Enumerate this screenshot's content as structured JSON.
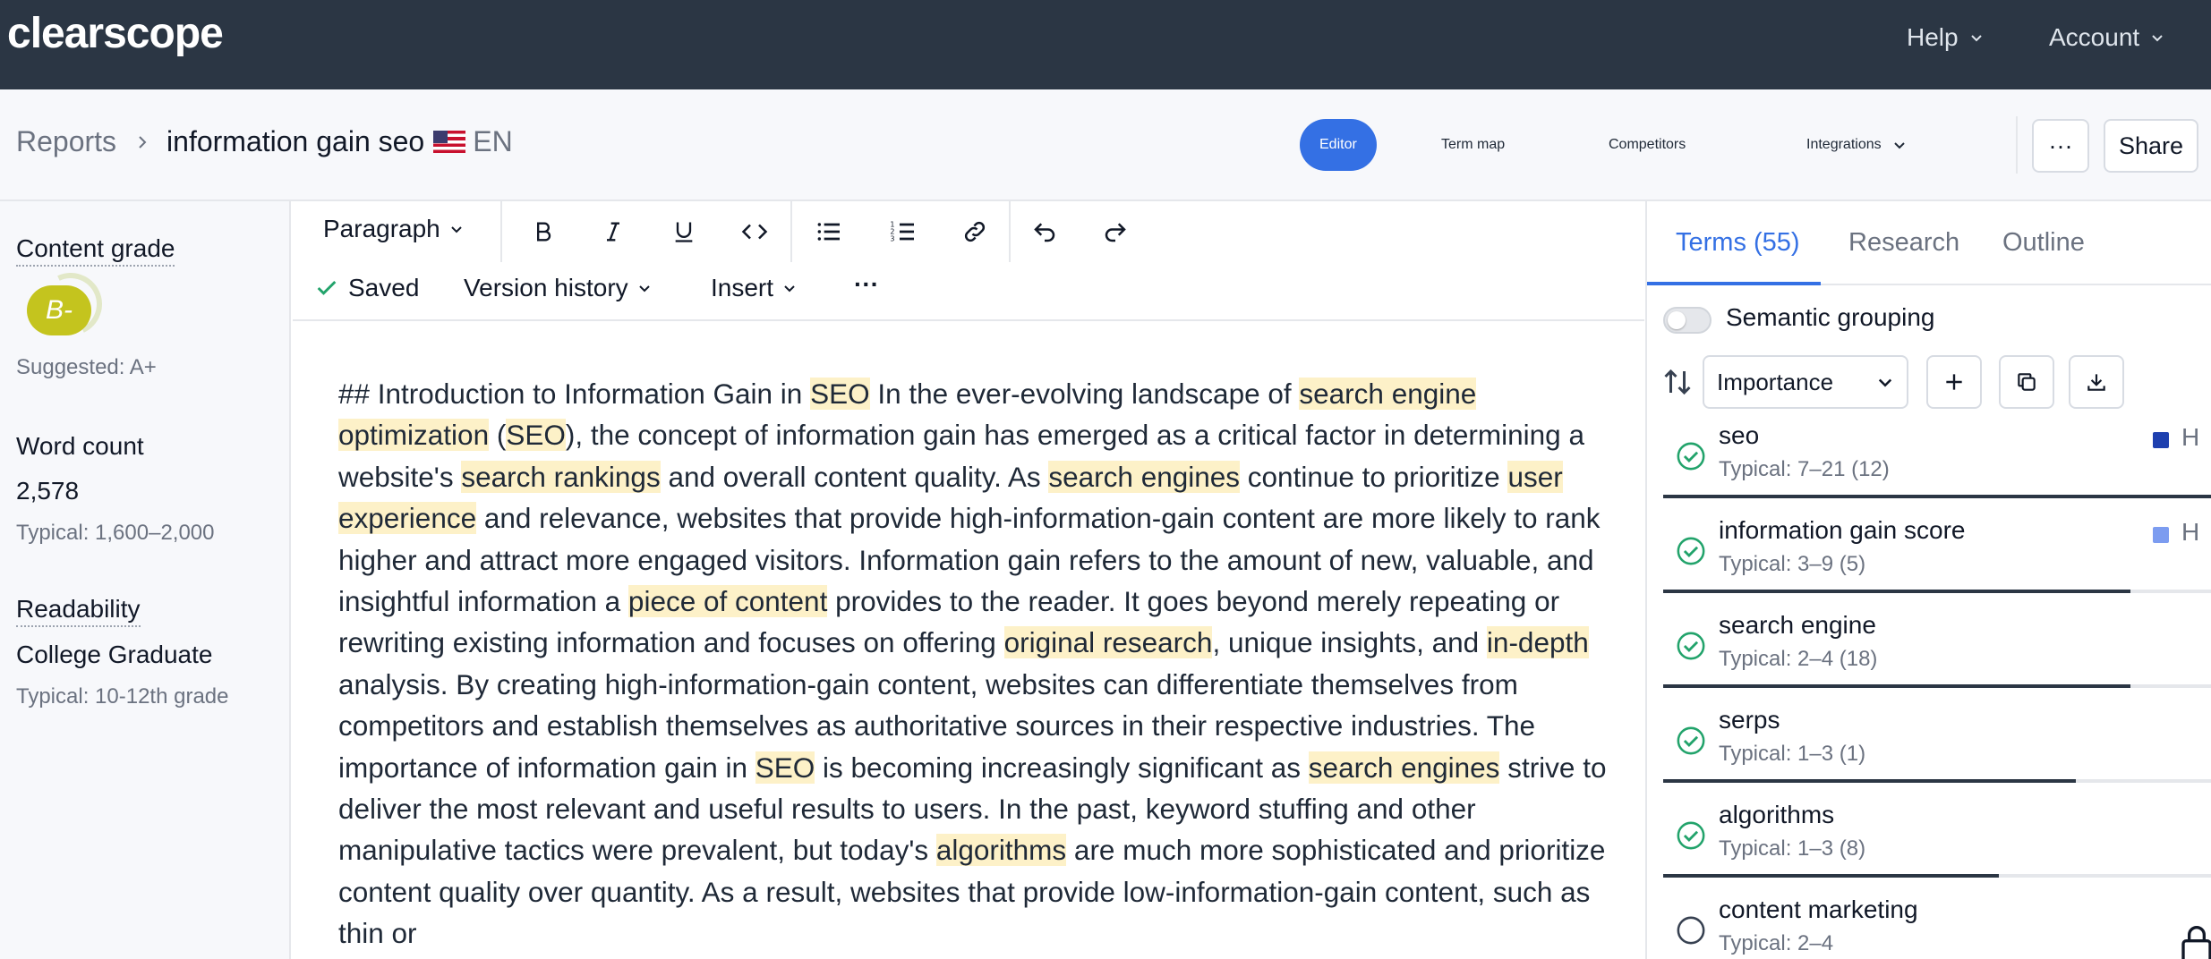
{
  "topbar": {
    "logo": "clearscope",
    "help": "Help",
    "account": "Account"
  },
  "header": {
    "breadcrumb_root": "Reports",
    "report_title": "information gain seo",
    "language": "EN",
    "tabs": {
      "editor": "Editor",
      "term_map": "Term map",
      "competitors": "Competitors",
      "integrations": "Integrations"
    },
    "more": "···",
    "share": "Share"
  },
  "sidebar": {
    "content_grade_label": "Content grade",
    "grade": "B-",
    "suggested": "Suggested: A+",
    "word_count_label": "Word count",
    "word_count": "2,578",
    "word_count_typical": "Typical: 1,600–2,000",
    "readability_label": "Readability",
    "readability": "College Graduate",
    "readability_typical": "Typical: 10-12th grade"
  },
  "toolbar": {
    "paragraph": "Paragraph",
    "saved": "Saved",
    "version_history": "Version history",
    "insert": "Insert",
    "more": "···"
  },
  "editor": {
    "segments": [
      {
        "t": "## Introduction to Information Gain in ",
        "h": false
      },
      {
        "t": "SEO",
        "h": true
      },
      {
        "t": " In the ever-evolving landscape of ",
        "h": false
      },
      {
        "t": "search engine optimization",
        "h": true
      },
      {
        "t": " (",
        "h": false
      },
      {
        "t": "SEO",
        "h": true
      },
      {
        "t": "), the concept of information gain has emerged as a critical factor in determining a website's ",
        "h": false
      },
      {
        "t": "search rankings",
        "h": true
      },
      {
        "t": " and overall content quality. As ",
        "h": false
      },
      {
        "t": "search engines",
        "h": true
      },
      {
        "t": " continue to prioritize ",
        "h": false
      },
      {
        "t": "user experience",
        "h": true
      },
      {
        "t": " and relevance, websites that provide high-information-gain content are more likely to rank higher and attract more engaged visitors. Information gain refers to the amount of new, valuable, and insightful information a ",
        "h": false
      },
      {
        "t": "piece of content",
        "h": true
      },
      {
        "t": " provides to the reader. It goes beyond merely repeating or rewriting existing information and focuses on offering ",
        "h": false
      },
      {
        "t": "original research",
        "h": true
      },
      {
        "t": ", unique insights, and ",
        "h": false
      },
      {
        "t": "in-depth",
        "h": true
      },
      {
        "t": " analysis. By creating high-information-gain content, websites can differentiate themselves from competitors and establish themselves as authoritative sources in their respective industries. The importance of information gain in ",
        "h": false
      },
      {
        "t": "SEO",
        "h": true
      },
      {
        "t": " is becoming increasingly significant as ",
        "h": false
      },
      {
        "t": "search engines",
        "h": true
      },
      {
        "t": " strive to deliver the most relevant and useful results to users. In the past, keyword stuffing and other manipulative tactics were prevalent, but today's ",
        "h": false
      },
      {
        "t": "algorithms",
        "h": true
      },
      {
        "t": " are much more sophisticated and prioritize content quality over quantity. As a result, websites that provide low-information-gain content, such as thin or",
        "h": false
      }
    ]
  },
  "right_panel": {
    "tabs": {
      "terms": "Terms (55)",
      "research": "Research",
      "outline": "Outline"
    },
    "semantic_grouping": "Semantic grouping",
    "sort_select": "Importance",
    "terms": [
      {
        "name": "seo",
        "typical": "Typical: 7–21 (12)",
        "done": true,
        "progress": 1.0,
        "marker": "H",
        "marker_color": "#1e40af"
      },
      {
        "name": "information gain score",
        "typical": "Typical: 3–9 (5)",
        "done": true,
        "progress": 0.85,
        "marker": "H",
        "marker_color": "#7c9cf0"
      },
      {
        "name": "search engine",
        "typical": "Typical: 2–4 (18)",
        "done": true,
        "progress": 0.85,
        "marker": "",
        "marker_color": ""
      },
      {
        "name": "serps",
        "typical": "Typical: 1–3 (1)",
        "done": true,
        "progress": 0.75,
        "marker": "",
        "marker_color": ""
      },
      {
        "name": "algorithms",
        "typical": "Typical: 1–3 (8)",
        "done": true,
        "progress": 0.61,
        "marker": "",
        "marker_color": ""
      },
      {
        "name": "content marketing",
        "typical": "Typical: 2–4",
        "done": false,
        "progress": 0.0,
        "marker": "",
        "marker_color": ""
      }
    ]
  },
  "colors": {
    "topbar": "#2b3644",
    "accent": "#3470e4",
    "highlight": "#fdf1c8",
    "grade": "#c4c41e",
    "check": "#22a36b"
  }
}
